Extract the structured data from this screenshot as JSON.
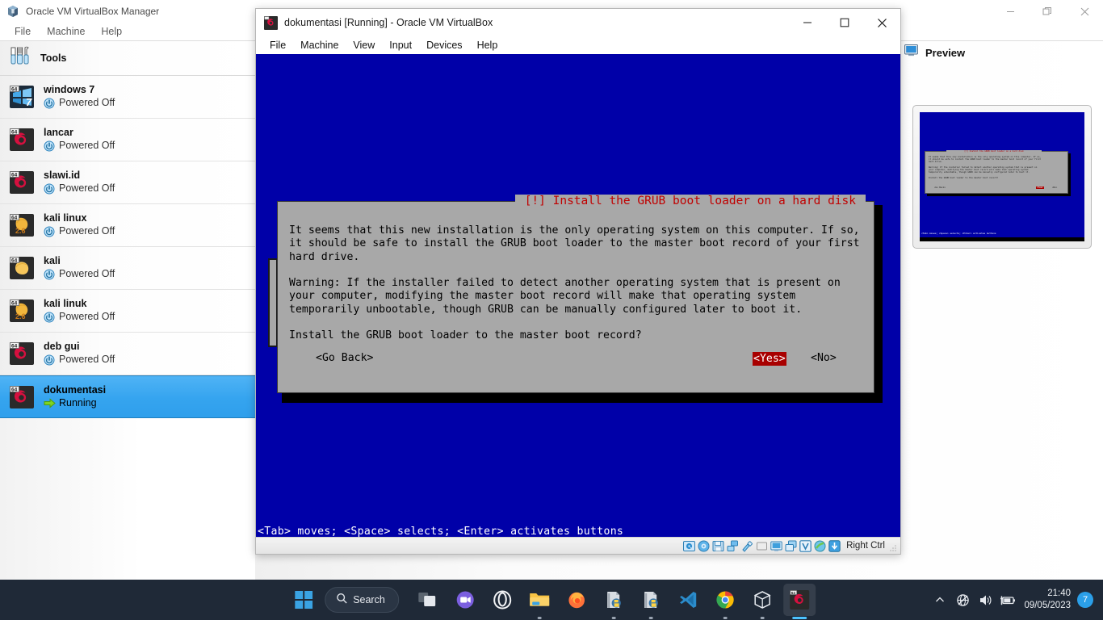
{
  "manager": {
    "title": "Oracle VM VirtualBox Manager",
    "icon": "virtualbox-logo-icon",
    "menu": [
      "File",
      "Machine",
      "Help"
    ],
    "window_buttons": {
      "minimize": "minimize-icon",
      "restore": "restore-icon",
      "close": "close-icon"
    },
    "tools": {
      "label": "Tools",
      "icon": "tools-icon"
    },
    "vms": [
      {
        "name": "windows 7",
        "state": "Powered Off",
        "os_icon": "windows7-icon",
        "state_icon": "power-off-icon",
        "selected": false,
        "badge": "64"
      },
      {
        "name": "lancar",
        "state": "Powered Off",
        "os_icon": "debian-icon",
        "state_icon": "power-off-icon",
        "selected": false,
        "badge": "64"
      },
      {
        "name": "slawi.id",
        "state": "Powered Off",
        "os_icon": "debian-icon",
        "state_icon": "power-off-icon",
        "selected": false,
        "badge": "64"
      },
      {
        "name": "kali linux",
        "state": "Powered Off",
        "os_icon": "linux-26-icon",
        "state_icon": "power-off-icon",
        "selected": false,
        "badge": "64",
        "version": "2.6"
      },
      {
        "name": "kali",
        "state": "Powered Off",
        "os_icon": "linux-icon",
        "state_icon": "power-off-icon",
        "selected": false,
        "badge": "64"
      },
      {
        "name": "kali linuk",
        "state": "Powered Off",
        "os_icon": "linux-26-icon",
        "state_icon": "power-off-icon",
        "selected": false,
        "badge": "64",
        "version": "2.6"
      },
      {
        "name": "deb gui",
        "state": "Powered Off",
        "os_icon": "debian-icon",
        "state_icon": "power-off-icon",
        "selected": false,
        "badge": "64"
      },
      {
        "name": "dokumentasi",
        "state": "Running",
        "os_icon": "debian-icon",
        "state_icon": "running-arrow-icon",
        "selected": true,
        "badge": "64"
      }
    ],
    "details": {
      "preview": {
        "label": "Preview",
        "icon": "monitor-icon"
      }
    }
  },
  "vm_window": {
    "title": "dokumentasi [Running] - Oracle VM VirtualBox",
    "icon": "debian-icon",
    "menu": [
      "File",
      "Machine",
      "View",
      "Input",
      "Devices",
      "Help"
    ],
    "window_buttons": {
      "minimize": "minimize-icon",
      "maximize": "maximize-icon",
      "close": "close-icon"
    },
    "statusbar": {
      "icons": [
        "hard-disk-icon",
        "optical-disk-icon",
        "floppy-disk-icon",
        "network-icon",
        "usb-icon",
        "shared-folders-icon",
        "display-icon",
        "recording-icon",
        "virtualization-icon",
        "mouse-integration-icon",
        "keyboard-icon"
      ],
      "host_key": "Right Ctrl",
      "grip": "resize-grip-icon"
    },
    "screen": {
      "background_color": "#0000a8",
      "dialog": {
        "title": "[!] Install the GRUB boot loader on a hard disk",
        "title_color": "#c00000",
        "background_color": "#a8a8a8",
        "body": "It seems that this new installation is the only operating system on this computer. If so,\nit should be safe to install the GRUB boot loader to the master boot record of your first\nhard drive.\n\nWarning: If the installer failed to detect another operating system that is present on\nyour computer, modifying the master boot record will make that operating system\ntemporarily unbootable, though GRUB can be manually configured later to boot it.\n\nInstall the GRUB boot loader to the master boot record?",
        "buttons": {
          "go_back": "<Go Back>",
          "yes": "<Yes>",
          "no": "<No>",
          "selected": "<Yes>",
          "selected_bg": "#a80000",
          "selected_fg": "#ffffff"
        }
      },
      "hint_line": "<Tab> moves; <Space> selects; <Enter> activates buttons"
    }
  },
  "taskbar": {
    "start": "windows-start-icon",
    "search": {
      "label": "Search",
      "icon": "search-icon"
    },
    "apps": [
      {
        "name": "task-view-icon",
        "active": false,
        "running": false
      },
      {
        "name": "microsoft-teams-icon",
        "active": false,
        "running": false
      },
      {
        "name": "opera-gx-icon",
        "active": false,
        "running": false
      },
      {
        "name": "file-explorer-icon",
        "active": false,
        "running": true
      },
      {
        "name": "firefox-icon",
        "active": false,
        "running": false
      },
      {
        "name": "python-idle-icon",
        "active": false,
        "running": true
      },
      {
        "name": "python-idle-icon",
        "active": false,
        "running": true
      },
      {
        "name": "visual-studio-code-icon",
        "active": false,
        "running": false
      },
      {
        "name": "google-chrome-icon",
        "active": false,
        "running": true
      },
      {
        "name": "virtualbox-icon",
        "active": false,
        "running": true
      },
      {
        "name": "debian-vm-icon",
        "active": true,
        "running": true
      }
    ],
    "tray": {
      "chevron": "show-hidden-icons-icon",
      "network": "network-globe-icon",
      "volume": "volume-icon",
      "battery": "battery-charging-icon",
      "time": "21:40",
      "date": "09/05/2023",
      "notification_count": "7"
    }
  },
  "colors": {
    "vm_blue": "#0000a8",
    "dialog_gray": "#a8a8a8",
    "dialog_title_red": "#c00000",
    "selection_blue": "#35a4ef",
    "taskbar": "#1f2937",
    "accent": "#2b9fe8"
  }
}
